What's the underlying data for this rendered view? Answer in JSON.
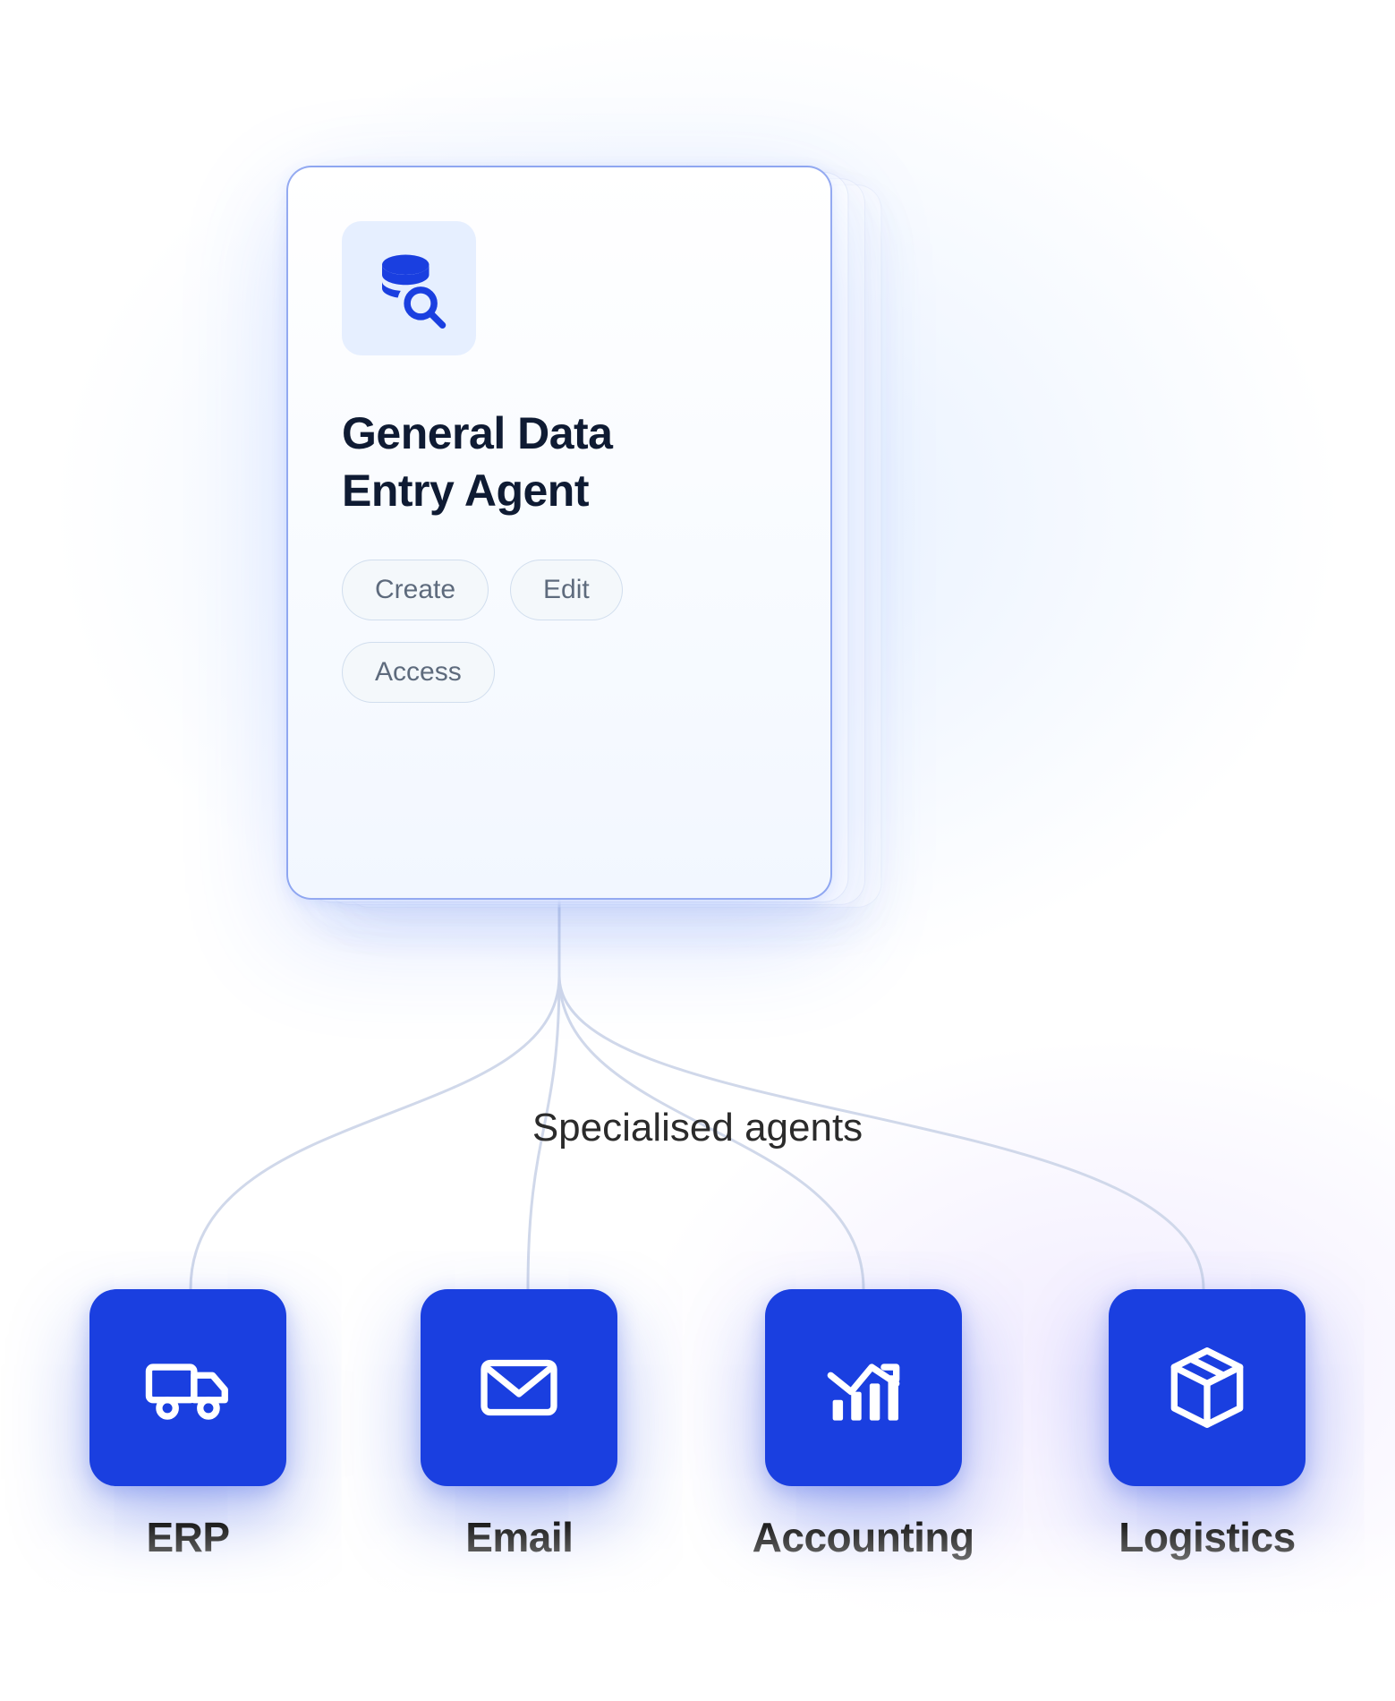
{
  "agent": {
    "title_line1": "General Data",
    "title_line2": "Entry Agent",
    "icon": "database-search-icon",
    "tags": [
      "Create",
      "Edit",
      "Access"
    ]
  },
  "section_label": "Specialised agents",
  "specialised_agents": [
    {
      "label": "ERP",
      "icon": "truck-icon"
    },
    {
      "label": "Email",
      "icon": "mail-icon"
    },
    {
      "label": "Accounting",
      "icon": "chart-icon"
    },
    {
      "label": "Logistics",
      "icon": "package-icon"
    }
  ],
  "colors": {
    "accent": "#1a3fe0",
    "card_border": "#3c64e6",
    "icon_bg": "#e6efff",
    "text_dark": "#0f1b33",
    "tag_text": "#5e6b7d"
  }
}
